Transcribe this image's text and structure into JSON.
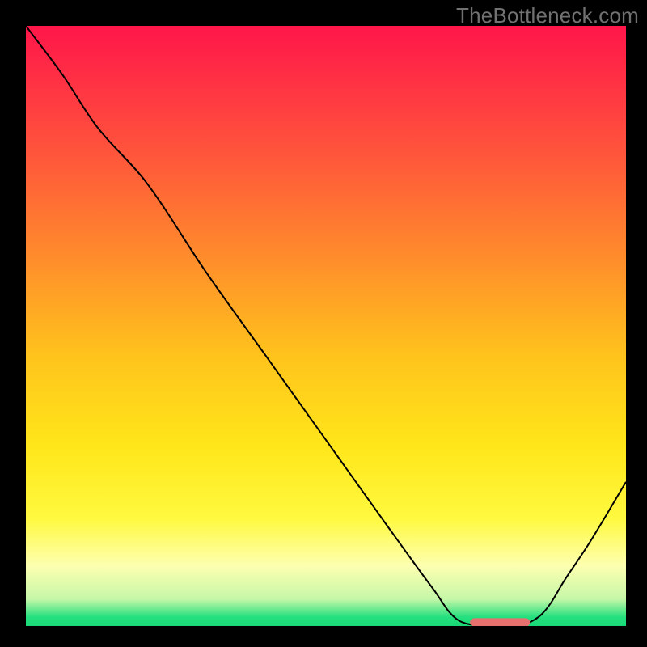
{
  "watermark": "TheBottleneck.com",
  "chart_data": {
    "type": "line",
    "title": "",
    "xlabel": "",
    "ylabel": "",
    "xlim": [
      0,
      100
    ],
    "ylim": [
      0,
      100
    ],
    "grid": false,
    "background_gradient": {
      "stops": [
        {
          "offset": 0.0,
          "color": "#ff164a"
        },
        {
          "offset": 0.18,
          "color": "#ff4b3e"
        },
        {
          "offset": 0.38,
          "color": "#ff8a2c"
        },
        {
          "offset": 0.55,
          "color": "#ffc31c"
        },
        {
          "offset": 0.7,
          "color": "#ffe61a"
        },
        {
          "offset": 0.82,
          "color": "#fff93f"
        },
        {
          "offset": 0.9,
          "color": "#fdffb0"
        },
        {
          "offset": 0.955,
          "color": "#c6f7a8"
        },
        {
          "offset": 0.985,
          "color": "#25e07e"
        },
        {
          "offset": 1.0,
          "color": "#19d877"
        }
      ]
    },
    "series": [
      {
        "name": "bottleneck-curve",
        "color": "#000000",
        "x": [
          0,
          6,
          12,
          20,
          30,
          40,
          50,
          60,
          68,
          72,
          77,
          82,
          86,
          90,
          94,
          100
        ],
        "y": [
          100,
          92,
          83,
          74,
          59,
          45,
          31,
          17,
          6,
          1,
          0,
          0,
          2,
          8,
          14,
          24
        ]
      }
    ],
    "marker": {
      "name": "sweet-spot-marker",
      "color": "#e5706f",
      "x_start": 74,
      "x_end": 84,
      "y": 0.6,
      "thickness": 1.4
    }
  }
}
